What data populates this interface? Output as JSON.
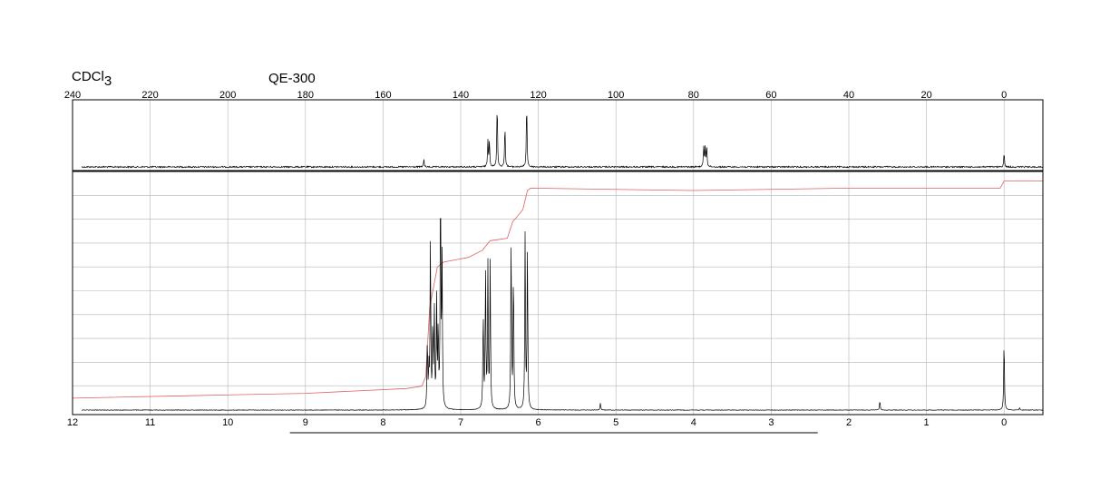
{
  "header": {
    "solvent": "CDCl",
    "solvent_sub": "3",
    "instrument": "QE-300"
  },
  "colors": {
    "spectrum": "#000000",
    "integral": "#e06060",
    "grid": "#b4b4b4",
    "frame": "#000000"
  },
  "chart_data": [
    {
      "type": "line",
      "name": "13C NMR spectrum",
      "xlim": [
        240,
        -10
      ],
      "x_reversed": true,
      "ylim": [
        0,
        1
      ],
      "grid": true,
      "x_ticks": [
        240,
        220,
        200,
        180,
        160,
        140,
        120,
        100,
        80,
        60,
        40,
        20,
        0
      ],
      "x_tick_labels": [
        "240",
        "220",
        "200",
        "180",
        "160",
        "140",
        "120",
        "100",
        "80",
        "60",
        "40",
        "20",
        "0"
      ],
      "peaks": [
        {
          "x": 149.5,
          "y": 0.12
        },
        {
          "x": 133.0,
          "y": 0.4
        },
        {
          "x": 132.6,
          "y": 0.42
        },
        {
          "x": 130.6,
          "y": 1.0
        },
        {
          "x": 128.6,
          "y": 0.64
        },
        {
          "x": 123.0,
          "y": 1.0
        },
        {
          "x": 77.4,
          "y": 0.31
        },
        {
          "x": 77.0,
          "y": 0.32
        },
        {
          "x": 76.6,
          "y": 0.31
        },
        {
          "x": 0.0,
          "y": 0.22
        }
      ]
    },
    {
      "type": "line",
      "name": "1H NMR spectrum",
      "xlim": [
        12,
        -0.5
      ],
      "x_reversed": true,
      "ylim": [
        0,
        1
      ],
      "grid": true,
      "x_ticks": [
        12,
        11,
        10,
        9,
        8,
        7,
        6,
        5,
        4,
        3,
        2,
        1,
        0
      ],
      "x_tick_labels": [
        "12",
        "11",
        "10",
        "9",
        "8",
        "7",
        "6",
        "5",
        "4",
        "3",
        "2",
        "1",
        "0"
      ],
      "peaks": [
        {
          "x": 7.43,
          "y": 0.3
        },
        {
          "x": 7.41,
          "y": 0.16
        },
        {
          "x": 7.39,
          "y": 0.74
        },
        {
          "x": 7.36,
          "y": 0.35
        },
        {
          "x": 7.34,
          "y": 0.43
        },
        {
          "x": 7.31,
          "y": 0.46
        },
        {
          "x": 7.29,
          "y": 0.34
        },
        {
          "x": 7.26,
          "y": 1.0
        },
        {
          "x": 7.24,
          "y": 0.64
        },
        {
          "x": 6.71,
          "y": 0.42
        },
        {
          "x": 6.68,
          "y": 0.6
        },
        {
          "x": 6.65,
          "y": 0.62
        },
        {
          "x": 6.62,
          "y": 0.63
        },
        {
          "x": 6.35,
          "y": 0.75
        },
        {
          "x": 6.32,
          "y": 0.61
        },
        {
          "x": 6.17,
          "y": 0.76
        },
        {
          "x": 6.14,
          "y": 0.7
        },
        {
          "x": 5.2,
          "y": 0.03
        },
        {
          "x": 1.6,
          "y": 0.04
        },
        {
          "x": 0.0,
          "y": 0.31
        },
        {
          "x": -0.2,
          "y": 0.01
        }
      ],
      "integral_curve": [
        [
          12.0,
          0.05
        ],
        [
          10.5,
          0.06
        ],
        [
          9.0,
          0.07
        ],
        [
          7.7,
          0.09
        ],
        [
          7.5,
          0.1
        ],
        [
          7.45,
          0.14
        ],
        [
          7.4,
          0.43
        ],
        [
          7.3,
          0.6
        ],
        [
          7.22,
          0.62
        ],
        [
          6.9,
          0.64
        ],
        [
          6.72,
          0.67
        ],
        [
          6.62,
          0.71
        ],
        [
          6.4,
          0.72
        ],
        [
          6.33,
          0.79
        ],
        [
          6.3,
          0.8
        ],
        [
          6.2,
          0.84
        ],
        [
          6.14,
          0.92
        ],
        [
          6.1,
          0.93
        ],
        [
          4.0,
          0.92
        ],
        [
          2.0,
          0.93
        ],
        [
          0.05,
          0.93
        ],
        [
          0.0,
          0.96
        ],
        [
          -0.5,
          0.96
        ]
      ],
      "integral_range": [
        9.2,
        2.4
      ]
    }
  ]
}
